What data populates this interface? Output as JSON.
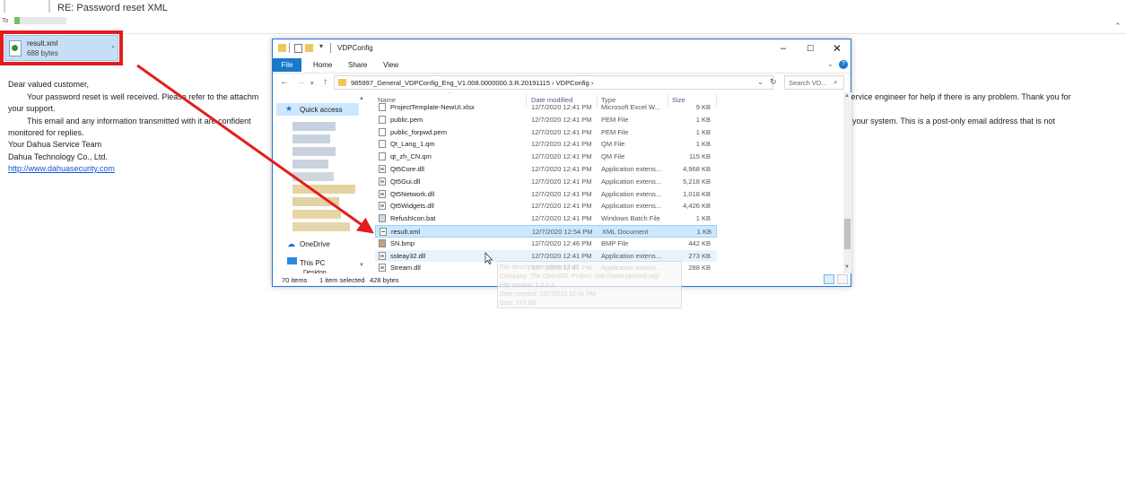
{
  "email": {
    "subject": "RE: Password reset XML",
    "to_label": "To",
    "attachment": {
      "name": "result.xml",
      "size": "688 bytes"
    },
    "body": {
      "greeting": "Dear valued customer,",
      "line1a": "Your password reset is well received. Please refer to the attachm",
      "line1b": "service engineer for help if there is any problem. Thank you for",
      "line2": "your support.",
      "line3a": "This email and any information transmitted with it are confident",
      "line3b": "your system. This is a post-only email address that is not",
      "line4": "monitored for replies.",
      "sig1": "Your Dahua Service Team",
      "sig2": "Dahua Technology Co., Ltd.",
      "link": "http://www.dahuasecurity.com"
    }
  },
  "explorer": {
    "title": "VDPConfig",
    "tabs": {
      "file": "File",
      "home": "Home",
      "share": "Share",
      "view": "View"
    },
    "address": "985997_General_VDPConfig_Eng_V1.008.0000000.3.R.20191115  ›  VDPConfig  ›",
    "search_placeholder": "Search VD...",
    "nav": {
      "quick_access": "Quick access",
      "onedrive": "OneDrive",
      "this_pc": "This PC",
      "desktop": "Desktop"
    },
    "columns": {
      "name": "Name",
      "date": "Date modified",
      "type": "Type",
      "size": "Size"
    },
    "files": [
      {
        "name": "ProjectTemplate-NewUI.xlsx",
        "date": "12/7/2020 12:41 PM",
        "type": "Microsoft Excel W...",
        "size": "9 KB",
        "icon": "doc"
      },
      {
        "name": "public.pem",
        "date": "12/7/2020 12:41 PM",
        "type": "PEM File",
        "size": "1 KB",
        "icon": "doc"
      },
      {
        "name": "public_forpwd.pem",
        "date": "12/7/2020 12:41 PM",
        "type": "PEM File",
        "size": "1 KB",
        "icon": "doc"
      },
      {
        "name": "Qt_Lang_1.qm",
        "date": "12/7/2020 12:41 PM",
        "type": "QM File",
        "size": "1 KB",
        "icon": "doc"
      },
      {
        "name": "qt_zh_CN.qm",
        "date": "12/7/2020 12:41 PM",
        "type": "QM File",
        "size": "115 KB",
        "icon": "doc"
      },
      {
        "name": "Qt5Core.dll",
        "date": "12/7/2020 12:41 PM",
        "type": "Application extens...",
        "size": "4,968 KB",
        "icon": "dll"
      },
      {
        "name": "Qt5Gui.dll",
        "date": "12/7/2020 12:41 PM",
        "type": "Application extens...",
        "size": "5,218 KB",
        "icon": "dll"
      },
      {
        "name": "Qt5Network.dll",
        "date": "12/7/2020 12:41 PM",
        "type": "Application extens...",
        "size": "1,018 KB",
        "icon": "dll"
      },
      {
        "name": "Qt5Widgets.dll",
        "date": "12/7/2020 12:41 PM",
        "type": "Application extens...",
        "size": "4,426 KB",
        "icon": "dll"
      },
      {
        "name": "RefushIcon.bat",
        "date": "12/7/2020 12:41 PM",
        "type": "Windows Batch File",
        "size": "1 KB",
        "icon": "bat"
      },
      {
        "name": "result.xml",
        "date": "12/7/2020 12:54 PM",
        "type": "XML Document",
        "size": "1 KB",
        "icon": "xml",
        "selected": true
      },
      {
        "name": "SN.bmp",
        "date": "12/7/2020 12:46 PM",
        "type": "BMP File",
        "size": "442 KB",
        "icon": "bmp"
      },
      {
        "name": "ssleay32.dll",
        "date": "12/7/2020 12:41 PM",
        "type": "Application extens...",
        "size": "273 KB",
        "icon": "dll",
        "hover": true
      },
      {
        "name": "Stream.dll",
        "date": "12/7/2020 12:41 PM",
        "type": "Application extens...",
        "size": "288 KB",
        "icon": "dll"
      }
    ],
    "status": {
      "count": "70 items",
      "selected": "1 item selected",
      "size": "428 bytes"
    },
    "tooltip": [
      "File description: ssleay32.dll",
      "Company: The OpenSSL Project, http://www.openssl.org/",
      "File version: 1.0.2.8",
      "Date created: 12/7/2020 12:41 PM",
      "Size: 273 KB"
    ]
  },
  "colors": {
    "annotation_red": "#e21d1d",
    "selection_blue": "#cce8ff",
    "accent": "#1979ca"
  }
}
